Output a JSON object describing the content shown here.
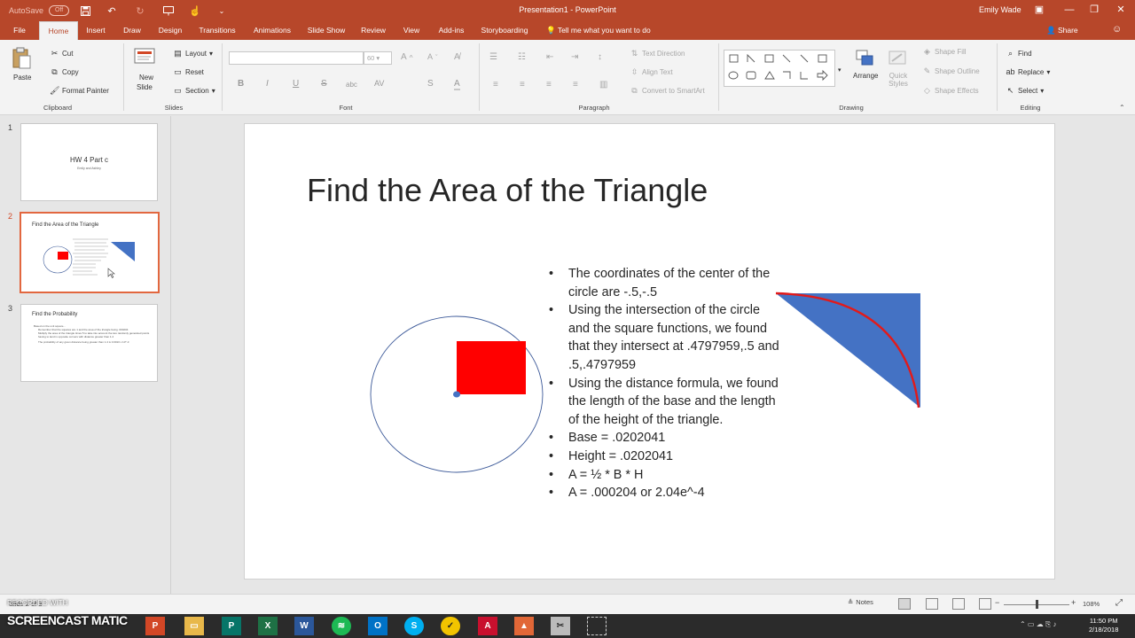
{
  "titlebar": {
    "autosave_label": "AutoSave",
    "autosave_state": "Off",
    "doc_title": "Presentation1 - PowerPoint",
    "user_name": "Emily Wade"
  },
  "tabs": [
    {
      "label": "File"
    },
    {
      "label": "Home"
    },
    {
      "label": "Insert"
    },
    {
      "label": "Draw"
    },
    {
      "label": "Design"
    },
    {
      "label": "Transitions"
    },
    {
      "label": "Animations"
    },
    {
      "label": "Slide Show"
    },
    {
      "label": "Review"
    },
    {
      "label": "View"
    },
    {
      "label": "Add-ins"
    },
    {
      "label": "Storyboarding"
    }
  ],
  "tell_me": "Tell me what you want to do",
  "share": "Share",
  "ribbon": {
    "clipboard": {
      "paste": "Paste",
      "cut": "Cut",
      "copy": "Copy",
      "format_painter": "Format Painter",
      "label": "Clipboard"
    },
    "slides": {
      "new_slide": "New",
      "new_slide2": "Slide",
      "layout": "Layout",
      "reset": "Reset",
      "section": "Section",
      "label": "Slides"
    },
    "font": {
      "size": "60",
      "bold": "B",
      "italic": "I",
      "underline": "U",
      "strike": "S",
      "spacing": "abc",
      "case": "AV",
      "color": "A",
      "label": "Font"
    },
    "paragraph": {
      "text_direction": "Text Direction",
      "align_text": "Align Text",
      "smartart": "Convert to SmartArt",
      "label": "Paragraph"
    },
    "drawing": {
      "arrange": "Arrange",
      "quick_styles": "Quick Styles",
      "shape_fill": "Shape Fill",
      "shape_outline": "Shape Outline",
      "shape_effects": "Shape Effects",
      "label": "Drawing"
    },
    "editing": {
      "find": "Find",
      "replace": "Replace",
      "select": "Select",
      "label": "Editing"
    }
  },
  "thumbnails": [
    {
      "num": "1",
      "title": "HW 4 Part c",
      "subtitle": "Emily and Ashley"
    },
    {
      "num": "2",
      "title": "Find the Area of the Triangle"
    },
    {
      "num": "3",
      "title": "Find the Probability",
      "bullet1": "Based on the unit square...",
      "bullet2": "Remember that the squares are 1 and the area of the triangle being .000204",
      "bullet3": "Multiply the area of the triangle times 5 to take into account the two randomly generated points having to land in opposite corners with distance greater than 1.4",
      "bullet4": "The probability of any given distance being greater than 1.4 is 0.0010 x 10^-3"
    }
  ],
  "slide": {
    "title": "Find the Area of the Triangle",
    "bullets": [
      "The coordinates of the center of the circle are -.5,-.5",
      "Using the intersection of the circle and the square functions, we found that they intersect at .4797959,.5 and .5,.4797959",
      "Using the distance formula, we found the length of the base and the length of the height of the triangle.",
      "Base = .0202041",
      "Height = .0202041",
      "A = ½ * B * H",
      "A = .000204 or 2.04e^-4"
    ]
  },
  "statusbar": {
    "slide_info": "Slide 2 of 3",
    "notes": "Notes",
    "zoom": "108%"
  },
  "taskbar": {
    "watermark_top": "RECORDED WITH",
    "watermark_brand": "SCREENCAST",
    "watermark_brand2": "MATIC",
    "time": "11:50 PM",
    "date": "2/18/2018"
  },
  "colors": {
    "accent": "#b7472a",
    "square_fill": "#ff0000",
    "triangle_fill": "#4472c4",
    "arc_stroke": "#e21a1a",
    "circle_stroke": "#3d5a99"
  }
}
